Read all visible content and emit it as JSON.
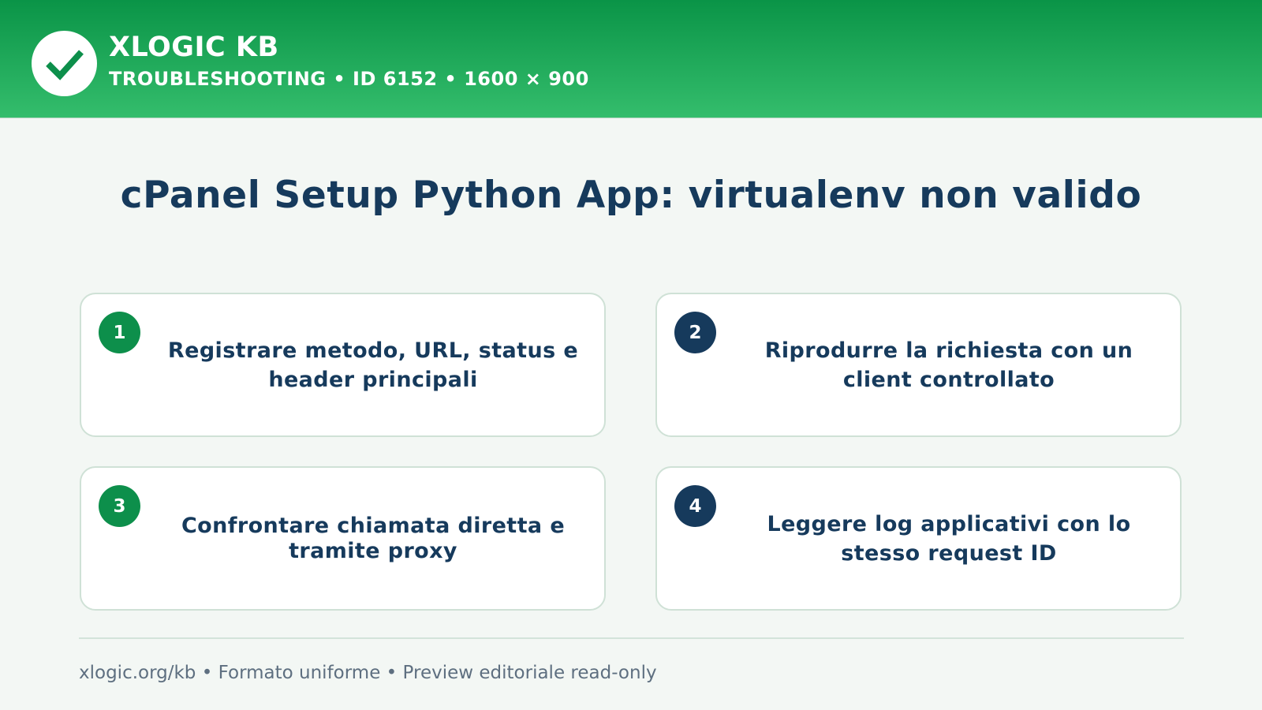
{
  "theme": {
    "header_top": "#0a9447",
    "header_bottom": "#34bd6c",
    "navy": "#163a5c",
    "green_badge": "#0d8f4b",
    "navy_badge": "#163a5c",
    "background": "#f3f7f4"
  },
  "header": {
    "logo_icon": "checkmark-icon",
    "brand": "XLOGIC KB",
    "subtitle": "TROUBLESHOOTING • ID 6152 • 1600 × 900"
  },
  "main": {
    "title": "cPanel Setup Python App: virtualenv non valido",
    "steps": [
      {
        "number": "1",
        "text": "Registrare metodo, URL, status e header principali",
        "badge_color": "#0d8f4b"
      },
      {
        "number": "2",
        "text": "Riprodurre la richiesta con un client controllato",
        "badge_color": "#163a5c"
      },
      {
        "number": "3",
        "text": "Confrontare chiamata diretta e tramite proxy",
        "badge_color": "#0d8f4b"
      },
      {
        "number": "4",
        "text": "Leggere log applicativi con lo stesso request ID",
        "badge_color": "#163a5c"
      }
    ]
  },
  "footer": {
    "text": "xlogic.org/kb • Formato uniforme • Preview editoriale read-only"
  }
}
